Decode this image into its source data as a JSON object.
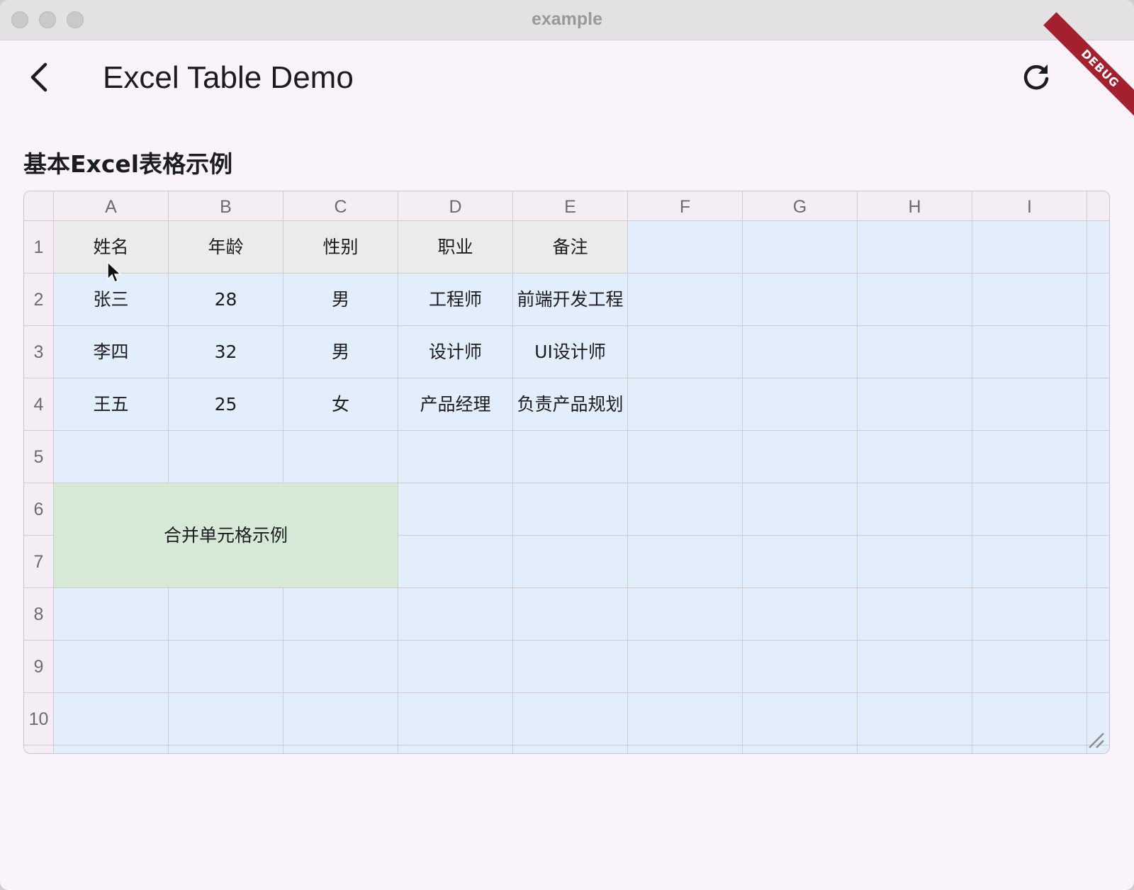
{
  "window": {
    "title": "example"
  },
  "appbar": {
    "title": "Excel Table Demo",
    "debug_label": "DEBUG"
  },
  "section": {
    "title": "基本Excel表格示例"
  },
  "sheet": {
    "columns": [
      "A",
      "B",
      "C",
      "D",
      "E",
      "F",
      "G",
      "H",
      "I"
    ],
    "rows": [
      "1",
      "2",
      "3",
      "4",
      "5",
      "6",
      "7",
      "8",
      "9",
      "10"
    ],
    "cells": [
      [
        "姓名",
        "年龄",
        "性别",
        "职业",
        "备注"
      ],
      [
        "张三",
        "28",
        "男",
        "工程师",
        "前端开发工程"
      ],
      [
        "李四",
        "32",
        "男",
        "设计师",
        "UI设计师"
      ],
      [
        "王五",
        "25",
        "女",
        "产品经理",
        "负责产品规划"
      ]
    ],
    "merged_cell": {
      "range": "A6:C7",
      "text": "合并单元格示例"
    }
  },
  "icons": {
    "back": "arrow-back-icon",
    "refresh": "refresh-icon",
    "resize": "resize-handle-icon",
    "cursor": "mouse-pointer-icon"
  },
  "colors": {
    "header_cell": "#ebebeb",
    "data_cell": "#e2eefb",
    "merged_cell": "#d6e9d6",
    "header_strip": "#f4edf4",
    "debug_banner": "#a3202f"
  }
}
